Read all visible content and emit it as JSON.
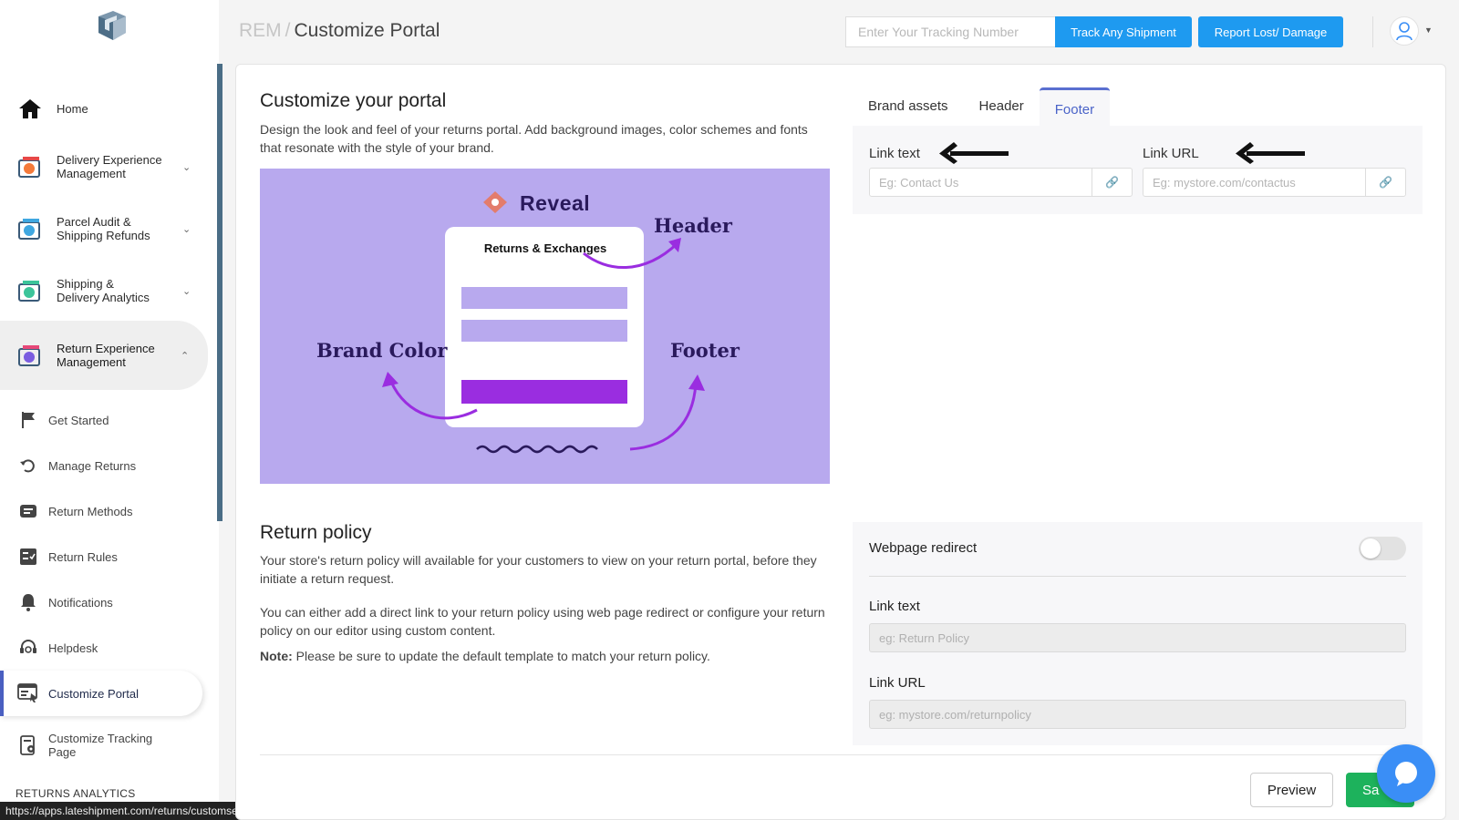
{
  "sidebar": {
    "main_items": [
      {
        "label": "Home",
        "icon": "home-icon"
      },
      {
        "label": "Delivery Experience\nManagement",
        "icon": "delivery-experience-icon"
      },
      {
        "label": "Parcel Audit &\nShipping Refunds",
        "icon": "parcel-audit-icon"
      },
      {
        "label": "Shipping &\nDelivery Analytics",
        "icon": "shipping-analytics-icon"
      },
      {
        "label": "Return Experience\nManagement",
        "icon": "return-experience-icon"
      }
    ],
    "sub_items": [
      {
        "label": "Get Started"
      },
      {
        "label": "Manage Returns"
      },
      {
        "label": "Return Methods"
      },
      {
        "label": "Return Rules"
      },
      {
        "label": "Notifications"
      },
      {
        "label": "Helpdesk"
      },
      {
        "label": "Customize Portal"
      },
      {
        "label": "Customize Tracking\nPage"
      }
    ],
    "section_label": "RETURNS ANALYTICS"
  },
  "status_url": "https://apps.lateshipment.com/returns/customsettings#",
  "topbar": {
    "breadcrumb_root": "REM",
    "breadcrumb_sep": "/",
    "breadcrumb_current": "Customize Portal",
    "tracking_placeholder": "Enter Your Tracking Number",
    "track_button": "Track Any Shipment",
    "report_button": "Report Lost/ Damage"
  },
  "customize": {
    "title": "Customize your portal",
    "description": "Design the look and feel of your returns portal. Add background images, color schemes and fonts that resonate with the style of your brand.",
    "illustration": {
      "brand": "Reveal",
      "card_title": "Returns & Exchanges",
      "header_label": "Header",
      "brand_color_label": "Brand Color",
      "footer_label": "Footer"
    }
  },
  "tabs": [
    {
      "label": "Brand assets"
    },
    {
      "label": "Header"
    },
    {
      "label": "Footer"
    }
  ],
  "footer_panel": {
    "link_text_label": "Link text",
    "link_text_placeholder": "Eg: Contact Us",
    "link_url_label": "Link URL",
    "link_url_placeholder": "Eg: mystore.com/contactus"
  },
  "return_policy": {
    "title": "Return policy",
    "paragraph1": "Your store's return policy will available for your customers to view on your return portal, before they initiate a return request.",
    "paragraph2": "You can either add a direct link to your return policy using web page redirect or configure your return policy on our editor using custom content.",
    "note_label": "Note:",
    "note_text": " Please be sure to update the default template to match your return policy.",
    "redirect_label": "Webpage redirect",
    "redirect_enabled": false,
    "link_text_label": "Link text",
    "link_text_placeholder": "eg: Return Policy",
    "link_url_label": "Link URL",
    "link_url_placeholder": "eg: mystore.com/returnpolicy"
  },
  "actions": {
    "preview": "Preview",
    "save": "Sa"
  },
  "colors": {
    "accent_blue": "#1e9af0",
    "active_tab": "#4a63c8",
    "save_green": "#1db25c",
    "illustration_bg": "#b8a9ee",
    "illustration_purple": "#9a2de0"
  }
}
